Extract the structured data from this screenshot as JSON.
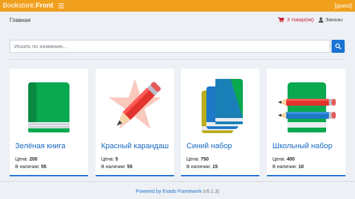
{
  "navbar": {
    "brand_prefix": "Bookstore.",
    "brand_bold": "Front",
    "user": "[guest]"
  },
  "breadcrumb": {
    "home": "Главная"
  },
  "cart": {
    "label": "3 товар(ов)"
  },
  "orders": {
    "label": "Заказы"
  },
  "search": {
    "placeholder": "Искать по названию..."
  },
  "products": [
    {
      "title": "Зелёная книга",
      "price_label": "Цена:",
      "price": "200",
      "stock_label": "В наличии:",
      "stock": "55",
      "icon": "green-book-icon"
    },
    {
      "title": "Красный карандаш",
      "price_label": "Цена:",
      "price": "5",
      "stock_label": "В наличии:",
      "stock": "55",
      "icon": "red-pencil-icon"
    },
    {
      "title": "Синий набор",
      "price_label": "Цена:",
      "price": "750",
      "stock_label": "В наличии:",
      "stock": "15",
      "icon": "book-set-icon"
    },
    {
      "title": "Школьный набор",
      "price_label": "Цена:",
      "price": "400",
      "stock_label": "В наличии:",
      "stock": "10",
      "icon": "school-set-icon"
    }
  ],
  "footer": {
    "powered": "Powered by Evado Framework",
    "version": "(v5.1.3)"
  },
  "colors": {
    "navbar": "#f1a01e",
    "accent": "#1b73d3",
    "cart": "#c82333"
  }
}
